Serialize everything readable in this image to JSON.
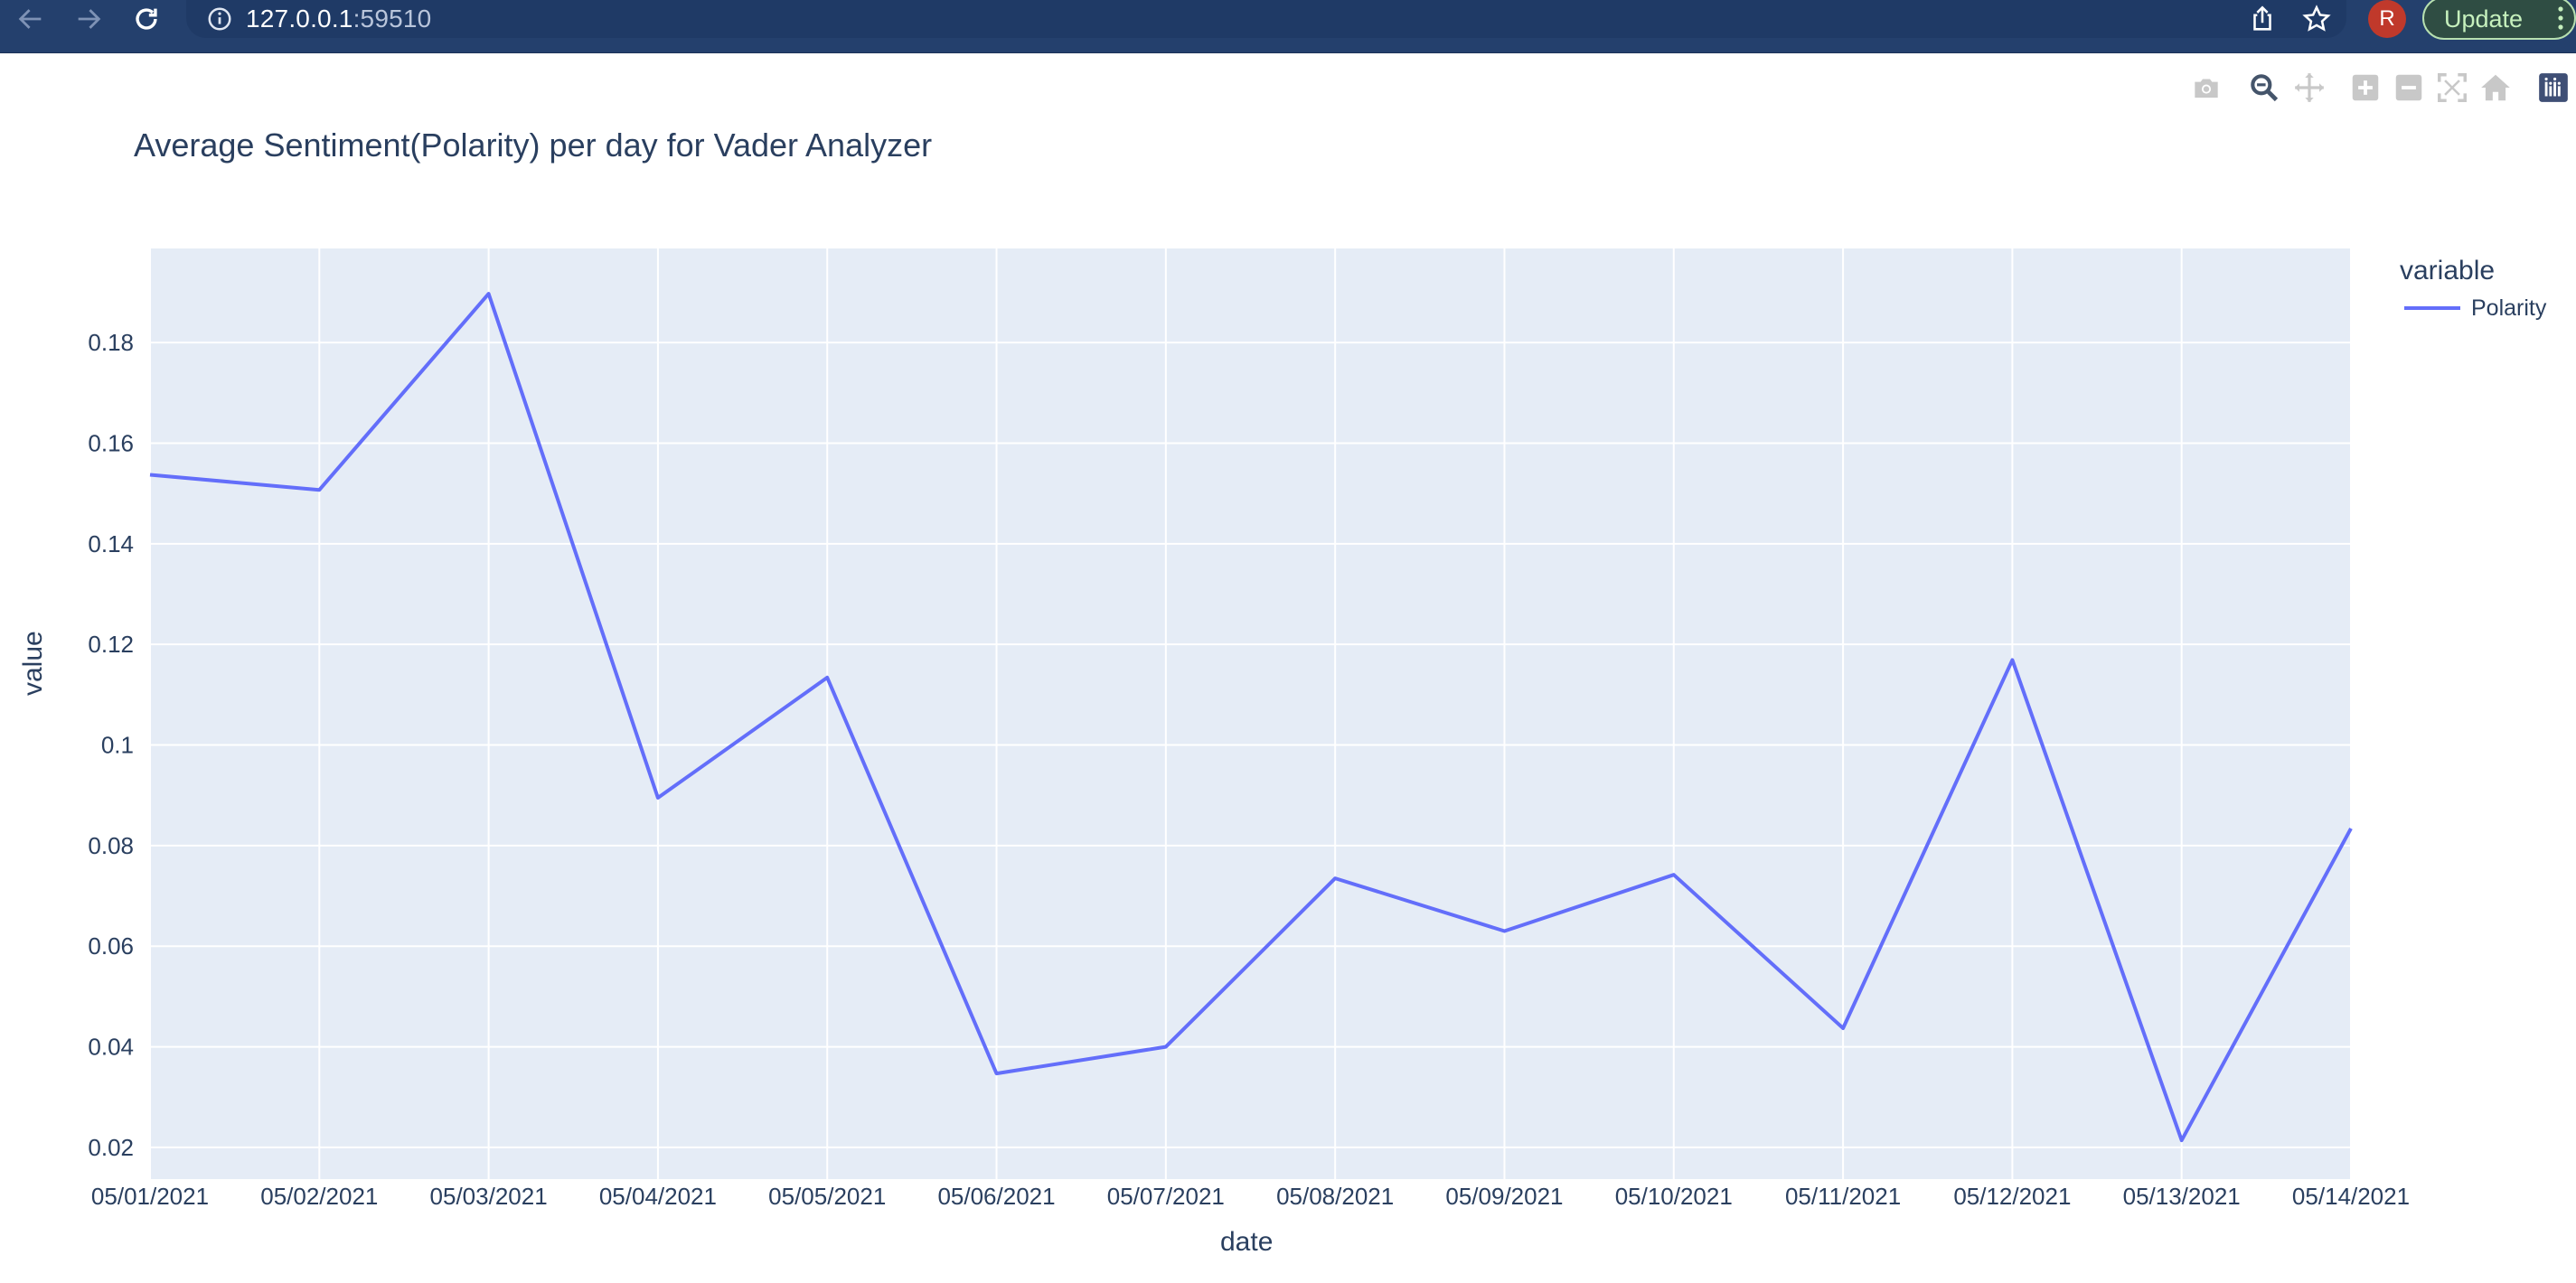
{
  "browser": {
    "url_host": "127.0.0.1",
    "url_port": ":59510",
    "avatar_letter": "R",
    "update_label": "Update"
  },
  "icons": {
    "back": "arrow-left-icon",
    "forward": "arrow-right-icon",
    "reload": "reload-icon",
    "info": "info-icon",
    "share": "share-icon",
    "bookmark": "star-icon",
    "menu": "kebab-menu-icon"
  },
  "modebar": {
    "buttons": [
      "camera-icon",
      "zoom-icon",
      "pan-icon",
      "zoom-in-icon",
      "zoom-out-icon",
      "autoscale-icon",
      "reset-axes-icon",
      "plotly-logo-icon"
    ]
  },
  "colors": {
    "browser_bar": "#24406d",
    "plot_bg": "#e5ecf6",
    "line": "#636efa",
    "text": "#2a3f5f"
  },
  "chart_data": {
    "type": "line",
    "title": "Average Sentiment(Polarity) per day for Vader Analyzer",
    "xlabel": "date",
    "ylabel": "value",
    "legend_title": "variable",
    "legend_position": "right",
    "grid": true,
    "x": [
      "05/01/2021",
      "05/02/2021",
      "05/03/2021",
      "05/04/2021",
      "05/05/2021",
      "05/06/2021",
      "05/07/2021",
      "05/08/2021",
      "05/09/2021",
      "05/10/2021",
      "05/11/2021",
      "05/12/2021",
      "05/13/2021",
      "05/14/2021"
    ],
    "series": [
      {
        "name": "Polarity",
        "values": [
          0.1537,
          0.1507,
          0.1897,
          0.0895,
          0.1134,
          0.0347,
          0.04,
          0.0735,
          0.063,
          0.0742,
          0.0437,
          0.1169,
          0.0214,
          0.0834
        ]
      }
    ],
    "y_ticks": [
      "0.02",
      "0.04",
      "0.06",
      "0.08",
      "0.1",
      "0.12",
      "0.14",
      "0.16",
      "0.18"
    ],
    "ylim": [
      0.0137,
      0.1987
    ]
  }
}
